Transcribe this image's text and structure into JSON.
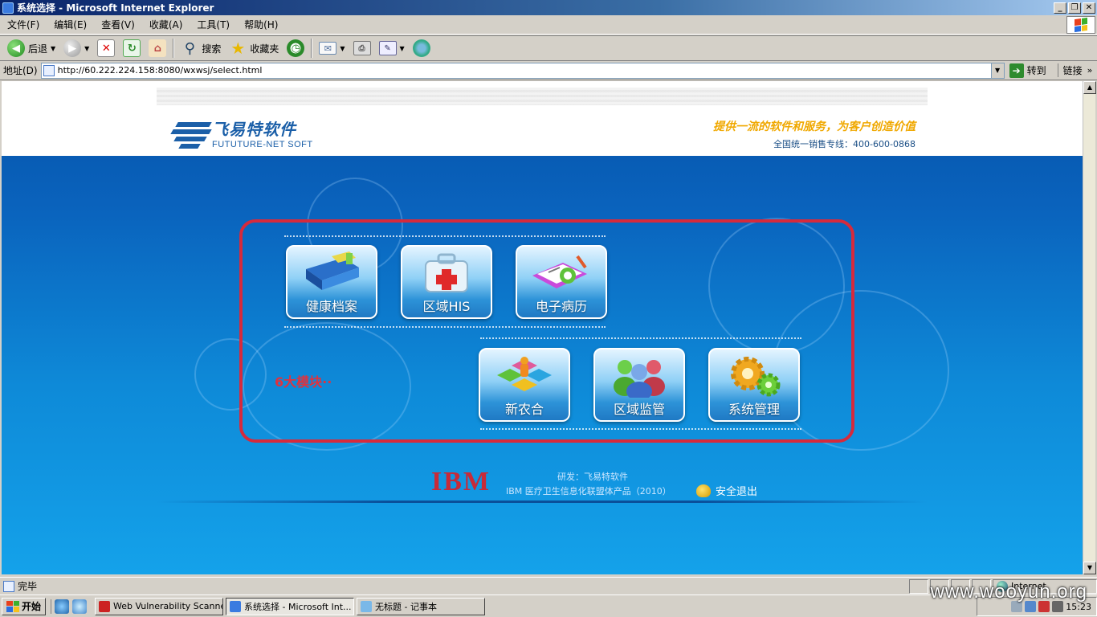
{
  "window": {
    "title": "系统选择 - Microsoft Internet Explorer"
  },
  "menu": [
    "文件(F)",
    "编辑(E)",
    "查看(V)",
    "收藏(A)",
    "工具(T)",
    "帮助(H)"
  ],
  "toolbar": {
    "back_label": "后退",
    "search_label": "搜索",
    "favorites_label": "收藏夹"
  },
  "address": {
    "label": "地址(D)",
    "url": "http://60.222.224.158:8080/wxwsj/select.html",
    "go_label": "转到",
    "links_label": "链接"
  },
  "page": {
    "logo_cn": "飞易特软件",
    "logo_en": "FUTUTURE-NET SOFT",
    "slogan": "提供一流的软件和服务，为客户创造价值",
    "hotline": "全国统一销售专线：400-600-0868",
    "modules": [
      "健康档案",
      "区域HIS",
      "电子病历",
      "新农合",
      "区域监管",
      "系统管理"
    ],
    "annotation": "6大模块··",
    "footer": {
      "ibm": "IBM",
      "dev": "研发：飞易特软件",
      "product": "IBM 医疗卫生信息化联盟体产品（2010）",
      "logout": "安全退出"
    },
    "colors": {
      "frame": "#d62a3c",
      "header_blue": "#1b5fa8",
      "slogan": "#f0a800"
    }
  },
  "status": {
    "text": "完毕",
    "zone": "Internet"
  },
  "taskbar": {
    "start": "开始",
    "tasks": [
      "Web Vulnerability Scanner",
      "系统选择 - Microsoft Int...",
      "无标题 - 记事本"
    ],
    "clock": "15:23"
  },
  "watermark": "www.wooyun.org"
}
